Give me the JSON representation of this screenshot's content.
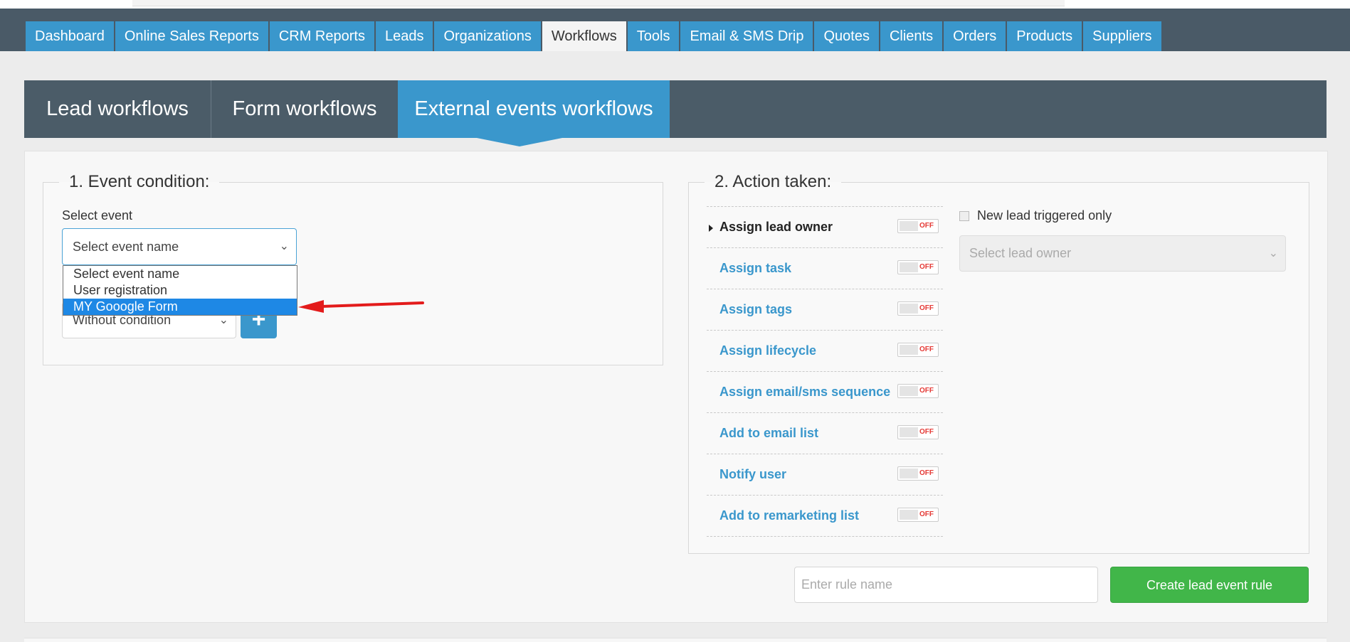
{
  "nav": {
    "tabs": [
      "Dashboard",
      "Online Sales Reports",
      "CRM Reports",
      "Leads",
      "Organizations",
      "Workflows",
      "Tools",
      "Email & SMS Drip",
      "Quotes",
      "Clients",
      "Orders",
      "Products",
      "Suppliers"
    ],
    "active": "Workflows"
  },
  "workflow_tabs": {
    "lead": "Lead workflows",
    "form": "Form workflows",
    "external": "External events workflows",
    "active": "External events workflows"
  },
  "event_condition": {
    "legend": "1. Event condition:",
    "select_label": "Select event",
    "select_value": "Select event name",
    "options": [
      "Select event name",
      "User registration",
      "MY Gooogle Form"
    ],
    "highlighted_option": "MY Gooogle Form",
    "condition_value": "Without condition",
    "add_label": "+"
  },
  "action_taken": {
    "legend": "2. Action taken:",
    "actions": [
      {
        "label": "Assign lead owner",
        "state": "OFF"
      },
      {
        "label": "Assign task",
        "state": "OFF"
      },
      {
        "label": "Assign tags",
        "state": "OFF"
      },
      {
        "label": "Assign lifecycle",
        "state": "OFF"
      },
      {
        "label": "Assign email/sms sequence",
        "state": "OFF"
      },
      {
        "label": "Add to email list",
        "state": "OFF"
      },
      {
        "label": "Notify user",
        "state": "OFF"
      },
      {
        "label": "Add to remarketing list",
        "state": "OFF"
      }
    ],
    "new_lead_only_label": "New lead triggered only",
    "owner_placeholder": "Select lead owner"
  },
  "footer": {
    "rule_placeholder": "Enter rule name",
    "create_label": "Create lead event rule"
  },
  "colors": {
    "primary": "#3a97cc",
    "header": "#4b5c68",
    "success": "#41b649",
    "annotation_arrow": "#e31b1b",
    "off": "#e53935"
  },
  "icons": {
    "dropdown": "chevron-down-icon",
    "add": "plus-icon",
    "expanded": "caret-right-icon",
    "annotation": "red-arrow-icon"
  }
}
